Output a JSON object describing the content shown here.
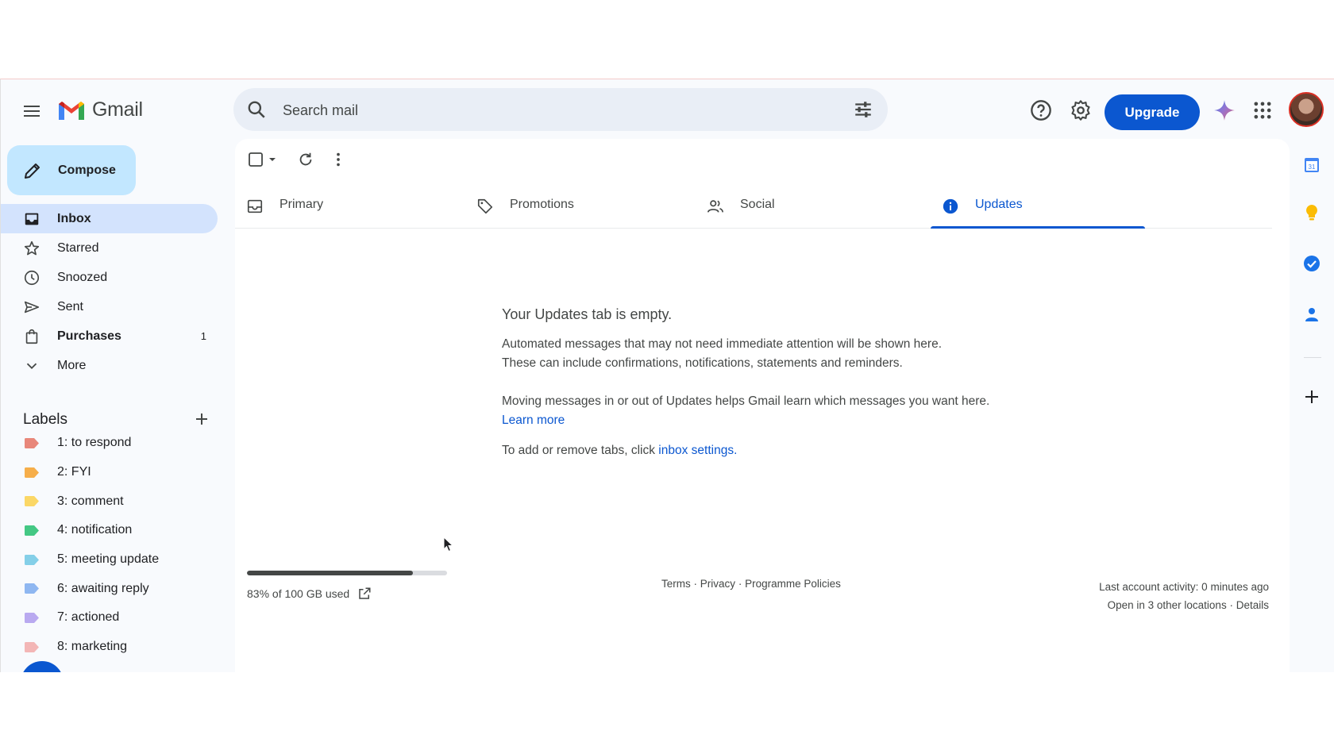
{
  "header": {
    "app_name": "Gmail",
    "search_placeholder": "Search mail",
    "upgrade_label": "Upgrade"
  },
  "sidebar": {
    "compose_label": "Compose",
    "items": [
      {
        "label": "Inbox",
        "icon": "inbox-icon",
        "active": true,
        "bold": true,
        "count": ""
      },
      {
        "label": "Starred",
        "icon": "star-icon",
        "active": false,
        "bold": false,
        "count": ""
      },
      {
        "label": "Snoozed",
        "icon": "clock-icon",
        "active": false,
        "bold": false,
        "count": ""
      },
      {
        "label": "Sent",
        "icon": "send-icon",
        "active": false,
        "bold": false,
        "count": ""
      },
      {
        "label": "Purchases",
        "icon": "shopping-bag-icon",
        "active": false,
        "bold": true,
        "count": "1"
      },
      {
        "label": "More",
        "icon": "chevron-down-icon",
        "active": false,
        "bold": false,
        "count": ""
      }
    ],
    "labels_heading": "Labels",
    "labels": [
      {
        "label": "1: to respond",
        "color": "#e8877a"
      },
      {
        "label": "2: FYI",
        "color": "#f6ae4a"
      },
      {
        "label": "3: comment",
        "color": "#fbd766"
      },
      {
        "label": "4: notification",
        "color": "#44c884"
      },
      {
        "label": "5: meeting update",
        "color": "#84cfe8"
      },
      {
        "label": "6: awaiting reply",
        "color": "#8fb7f1"
      },
      {
        "label": "7: actioned",
        "color": "#b9a9f0"
      },
      {
        "label": "8: marketing",
        "color": "#f3b6b6"
      }
    ]
  },
  "tabs": [
    {
      "label": "Primary",
      "icon": "inbox-tray-icon",
      "active": false
    },
    {
      "label": "Promotions",
      "icon": "tag-icon",
      "active": false
    },
    {
      "label": "Social",
      "icon": "people-icon",
      "active": false
    },
    {
      "label": "Updates",
      "icon": "info-icon",
      "active": true
    }
  ],
  "empty_state": {
    "title": "Your Updates tab is empty.",
    "line1": "Automated messages that may not need immediate attention will be shown here.",
    "line2": "These can include confirmations, notifications, statements and reminders.",
    "line3": "Moving messages in or out of Updates helps Gmail learn which messages you want here.",
    "learn_more": "Learn more",
    "line4_prefix": "To add or remove tabs, click",
    "inbox_settings": "inbox settings",
    "line4_suffix": "."
  },
  "footer": {
    "storage_text": "83% of 100 GB used",
    "storage_fraction": 0.83,
    "terms": "Terms",
    "privacy": "Privacy",
    "policies": "Programme Policies",
    "separator": "·",
    "last_activity": "Last account activity: 0 minutes ago",
    "open_locations": "Open in 3 other locations",
    "details": "Details"
  },
  "colors": {
    "accent": "#0b57d0",
    "active_nav_bg": "#d3e3fd",
    "compose_bg": "#c2e7ff"
  },
  "rail": {
    "calendar_day": "31"
  }
}
